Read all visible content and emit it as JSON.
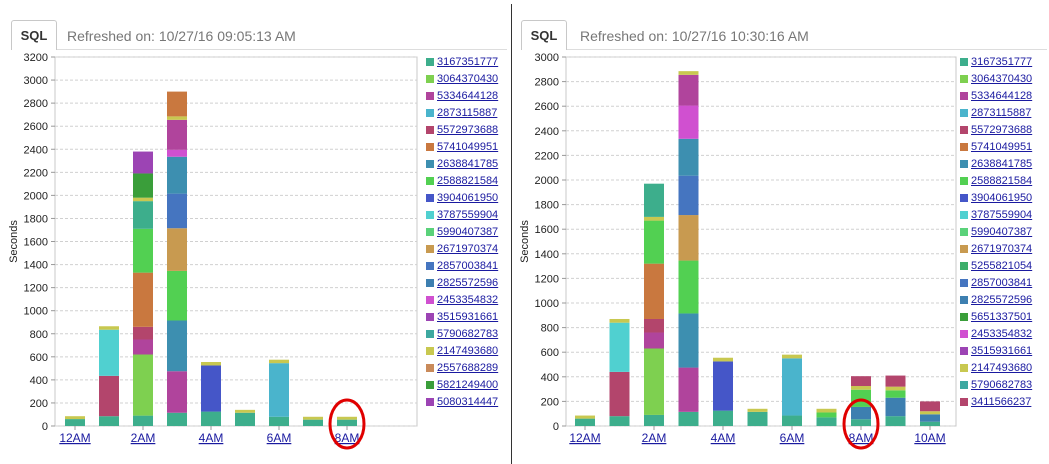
{
  "panels": [
    {
      "tab_label": "SQL",
      "refreshed_text": "Refreshed on: 10/27/16 09:05:13 AM",
      "chart_data": {
        "type": "bar",
        "stacked": true,
        "ylabel": "Seconds",
        "ylim": [
          0,
          3200
        ],
        "yticks": [
          0,
          200,
          400,
          600,
          800,
          1000,
          1200,
          1400,
          1600,
          1800,
          2000,
          2200,
          2400,
          2600,
          2800,
          3000,
          3200
        ],
        "xtick_labels": [
          "12AM",
          "2AM",
          "4AM",
          "6AM",
          "8AM"
        ],
        "grid": true,
        "legend_position": "right",
        "highlight": "8AM",
        "bars": [
          {
            "segments": [
              {
                "color": "#3dae8c",
                "value": 60
              },
              {
                "color": "#c8c850",
                "value": 25
              }
            ]
          },
          {
            "segments": [
              {
                "color": "#3dae8c",
                "value": 85
              },
              {
                "color": "#b3456c",
                "value": 350
              },
              {
                "color": "#50d0d0",
                "value": 400
              },
              {
                "color": "#c8c850",
                "value": 30
              }
            ]
          },
          {
            "segments": [
              {
                "color": "#3dae8c",
                "value": 90
              },
              {
                "color": "#7ed050",
                "value": 530
              },
              {
                "color": "#b0449c",
                "value": 130
              },
              {
                "color": "#b3456c",
                "value": 110
              },
              {
                "color": "#c9783f",
                "value": 470
              },
              {
                "color": "#52d052",
                "value": 380
              },
              {
                "color": "#3dae8c",
                "value": 240
              },
              {
                "color": "#c8c850",
                "value": 30
              },
              {
                "color": "#3a9e3a",
                "value": 210
              },
              {
                "color": "#9c44b4",
                "value": 190
              }
            ]
          },
          {
            "segments": [
              {
                "color": "#3dae8c",
                "value": 115
              },
              {
                "color": "#b0449c",
                "value": 360
              },
              {
                "color": "#3d8fb0",
                "value": 440
              },
              {
                "color": "#52d052",
                "value": 430
              },
              {
                "color": "#c89a50",
                "value": 370
              },
              {
                "color": "#4575c0",
                "value": 300
              },
              {
                "color": "#3d8fb0",
                "value": 320
              },
              {
                "color": "#d050d0",
                "value": 60
              },
              {
                "color": "#b0449c",
                "value": 260
              },
              {
                "color": "#c8c850",
                "value": 30
              },
              {
                "color": "#c9783f",
                "value": 215
              }
            ]
          },
          {
            "segments": [
              {
                "color": "#3dae8c",
                "value": 125
              },
              {
                "color": "#4556c8",
                "value": 400
              },
              {
                "color": "#c8c850",
                "value": 30
              }
            ]
          },
          {
            "segments": [
              {
                "color": "#3dae8c",
                "value": 115
              },
              {
                "color": "#c8c850",
                "value": 25
              }
            ]
          },
          {
            "segments": [
              {
                "color": "#3dae8c",
                "value": 80
              },
              {
                "color": "#4ab4cc",
                "value": 465
              },
              {
                "color": "#c8c850",
                "value": 30
              }
            ]
          },
          {
            "segments": [
              {
                "color": "#3dae8c",
                "value": 55
              },
              {
                "color": "#c8c850",
                "value": 25
              }
            ]
          },
          {
            "segments": [
              {
                "color": "#3dae8c",
                "value": 55
              },
              {
                "color": "#c8c850",
                "value": 25
              }
            ]
          }
        ],
        "legend": [
          {
            "label": "3167351777",
            "color": "#3dae8c"
          },
          {
            "label": "3064370430",
            "color": "#7ed050"
          },
          {
            "label": "5334644128",
            "color": "#b0449c"
          },
          {
            "label": "2873115887",
            "color": "#4ab4cc"
          },
          {
            "label": "5572973688",
            "color": "#b3456c"
          },
          {
            "label": "5741049951",
            "color": "#c9783f"
          },
          {
            "label": "2638841785",
            "color": "#3d8fb0"
          },
          {
            "label": "2588821584",
            "color": "#52d052"
          },
          {
            "label": "3904061950",
            "color": "#4556c8"
          },
          {
            "label": "3787559904",
            "color": "#50d0d0"
          },
          {
            "label": "5990407387",
            "color": "#5ad27a"
          },
          {
            "label": "2671970374",
            "color": "#c89a50"
          },
          {
            "label": "2857003841",
            "color": "#4575c0"
          },
          {
            "label": "2825572596",
            "color": "#3d7fb0"
          },
          {
            "label": "2453354832",
            "color": "#d050d0"
          },
          {
            "label": "3515931661",
            "color": "#9c44b4"
          },
          {
            "label": "5790682783",
            "color": "#3da8a0"
          },
          {
            "label": "2147493680",
            "color": "#c8c850"
          },
          {
            "label": "2557688289",
            "color": "#c98a5a"
          },
          {
            "label": "5821249400",
            "color": "#3a9e3a"
          },
          {
            "label": "5080314447",
            "color": "#9c44b4"
          }
        ]
      }
    },
    {
      "tab_label": "SQL",
      "refreshed_text": "Refreshed on: 10/27/16 10:30:16 AM",
      "chart_data": {
        "type": "bar",
        "stacked": true,
        "ylabel": "Seconds",
        "ylim": [
          0,
          3000
        ],
        "yticks": [
          0,
          200,
          400,
          600,
          800,
          1000,
          1200,
          1400,
          1600,
          1800,
          2000,
          2200,
          2400,
          2600,
          2800,
          3000
        ],
        "xtick_labels": [
          "12AM",
          "2AM",
          "4AM",
          "6AM",
          "8AM",
          "10AM"
        ],
        "grid": true,
        "legend_position": "right",
        "highlight": "8AM",
        "bars": [
          {
            "segments": [
              {
                "color": "#3dae8c",
                "value": 60
              },
              {
                "color": "#c8c850",
                "value": 25
              }
            ]
          },
          {
            "segments": [
              {
                "color": "#3dae8c",
                "value": 80
              },
              {
                "color": "#b3456c",
                "value": 360
              },
              {
                "color": "#50d0d0",
                "value": 400
              },
              {
                "color": "#c8c850",
                "value": 30
              }
            ]
          },
          {
            "segments": [
              {
                "color": "#3dae8c",
                "value": 90
              },
              {
                "color": "#7ed050",
                "value": 540
              },
              {
                "color": "#b0449c",
                "value": 130
              },
              {
                "color": "#b3456c",
                "value": 110
              },
              {
                "color": "#c9783f",
                "value": 450
              },
              {
                "color": "#52d052",
                "value": 350
              },
              {
                "color": "#c8c850",
                "value": 30
              },
              {
                "color": "#3dae8c",
                "value": 270
              }
            ]
          },
          {
            "segments": [
              {
                "color": "#3dae8c",
                "value": 115
              },
              {
                "color": "#b0449c",
                "value": 360
              },
              {
                "color": "#3d8fb0",
                "value": 440
              },
              {
                "color": "#52d052",
                "value": 430
              },
              {
                "color": "#c89a50",
                "value": 370
              },
              {
                "color": "#4575c0",
                "value": 320
              },
              {
                "color": "#3d8fb0",
                "value": 300
              },
              {
                "color": "#d050d0",
                "value": 270
              },
              {
                "color": "#b0449c",
                "value": 250
              },
              {
                "color": "#c8c850",
                "value": 30
              }
            ]
          },
          {
            "segments": [
              {
                "color": "#3dae8c",
                "value": 125
              },
              {
                "color": "#4556c8",
                "value": 400
              },
              {
                "color": "#c8c850",
                "value": 30
              }
            ]
          },
          {
            "segments": [
              {
                "color": "#3dae8c",
                "value": 115
              },
              {
                "color": "#c8c850",
                "value": 25
              }
            ]
          },
          {
            "segments": [
              {
                "color": "#3dae8c",
                "value": 85
              },
              {
                "color": "#4ab4cc",
                "value": 465
              },
              {
                "color": "#c8c850",
                "value": 30
              }
            ]
          },
          {
            "segments": [
              {
                "color": "#3dae8c",
                "value": 70
              },
              {
                "color": "#52d052",
                "value": 40
              },
              {
                "color": "#c8c850",
                "value": 30
              }
            ]
          },
          {
            "segments": [
              {
                "color": "#3dae8c",
                "value": 55
              },
              {
                "color": "#3d7fb0",
                "value": 100
              },
              {
                "color": "#52d052",
                "value": 140
              },
              {
                "color": "#c8c850",
                "value": 30
              },
              {
                "color": "#b3456c",
                "value": 80
              }
            ]
          },
          {
            "segments": [
              {
                "color": "#3dae8c",
                "value": 80
              },
              {
                "color": "#3d7fb0",
                "value": 150
              },
              {
                "color": "#52d052",
                "value": 60
              },
              {
                "color": "#c8c850",
                "value": 30
              },
              {
                "color": "#b3456c",
                "value": 90
              }
            ]
          },
          {
            "segments": [
              {
                "color": "#3dae8c",
                "value": 35
              },
              {
                "color": "#3d7fb0",
                "value": 60
              },
              {
                "color": "#c8c850",
                "value": 25
              },
              {
                "color": "#b3456c",
                "value": 80
              }
            ]
          }
        ],
        "legend": [
          {
            "label": "3167351777",
            "color": "#3dae8c"
          },
          {
            "label": "3064370430",
            "color": "#7ed050"
          },
          {
            "label": "5334644128",
            "color": "#b0449c"
          },
          {
            "label": "2873115887",
            "color": "#4ab4cc"
          },
          {
            "label": "5572973688",
            "color": "#b3456c"
          },
          {
            "label": "5741049951",
            "color": "#c9783f"
          },
          {
            "label": "2638841785",
            "color": "#3d8fb0"
          },
          {
            "label": "2588821584",
            "color": "#52d052"
          },
          {
            "label": "3904061950",
            "color": "#4556c8"
          },
          {
            "label": "3787559904",
            "color": "#50d0d0"
          },
          {
            "label": "5990407387",
            "color": "#5ad27a"
          },
          {
            "label": "2671970374",
            "color": "#c89a50"
          },
          {
            "label": "5255821054",
            "color": "#3dae6a"
          },
          {
            "label": "2857003841",
            "color": "#4575c0"
          },
          {
            "label": "2825572596",
            "color": "#3d7fb0"
          },
          {
            "label": "5651337501",
            "color": "#3a9e3a"
          },
          {
            "label": "2453354832",
            "color": "#d050d0"
          },
          {
            "label": "3515931661",
            "color": "#9c44b4"
          },
          {
            "label": "2147493680",
            "color": "#c8c850"
          },
          {
            "label": "5790682783",
            "color": "#3da8a0"
          },
          {
            "label": "3411566237",
            "color": "#b3456c"
          }
        ]
      }
    }
  ]
}
